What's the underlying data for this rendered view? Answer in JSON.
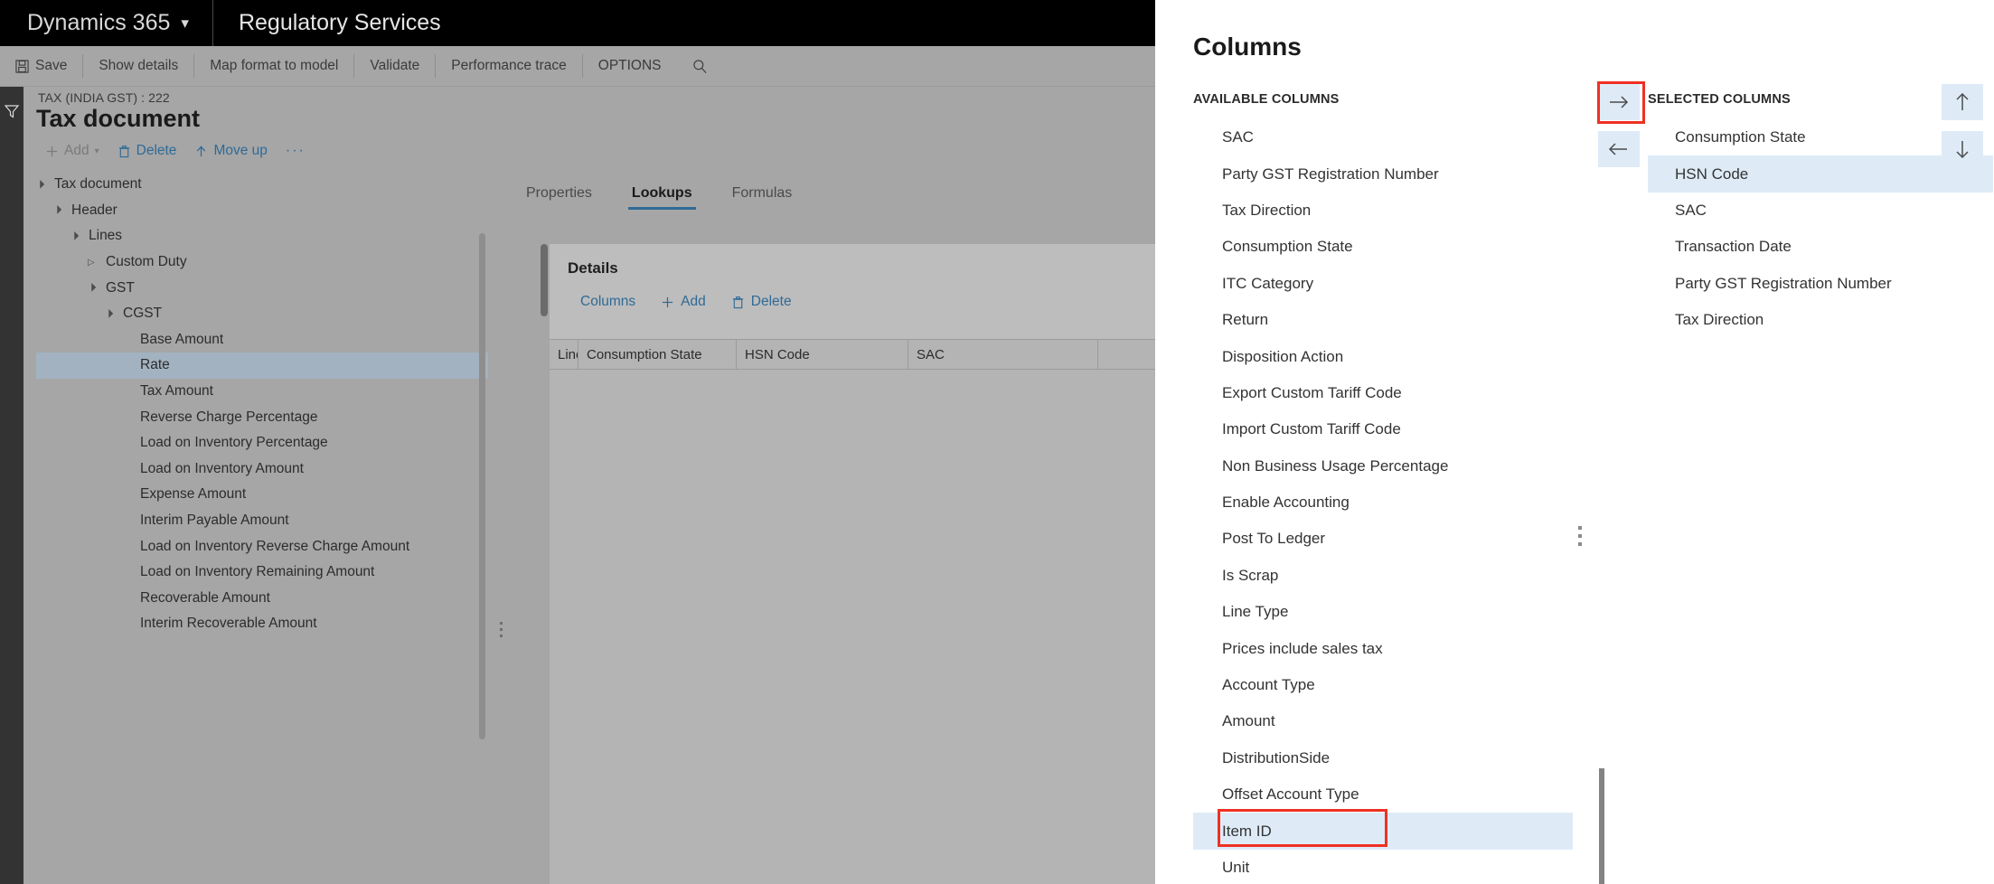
{
  "topbar": {
    "brand": "Dynamics 365",
    "brand_chevron": "chevron-down",
    "module": "Regulatory Services"
  },
  "command_bar": {
    "items": [
      {
        "label": "Save",
        "icon": "save-icon"
      },
      {
        "label": "Show details",
        "icon": ""
      },
      {
        "label": "Map format to model",
        "icon": ""
      },
      {
        "label": "Validate",
        "icon": ""
      },
      {
        "label": "Performance trace",
        "icon": ""
      },
      {
        "label": "OPTIONS",
        "icon": ""
      }
    ],
    "search_icon": "search-icon"
  },
  "page": {
    "breadcrumb": "TAX (INDIA GST) : 222",
    "title": "Tax document"
  },
  "tree_toolbar": {
    "add": "Add",
    "delete": "Delete",
    "move_up": "Move up",
    "overflow": "···"
  },
  "tree": {
    "nodes": [
      {
        "label": "Tax document",
        "indent": 0,
        "state": "open",
        "selected": false
      },
      {
        "label": "Header",
        "indent": 1,
        "state": "open",
        "selected": false
      },
      {
        "label": "Lines",
        "indent": 2,
        "state": "open",
        "selected": false
      },
      {
        "label": "Custom Duty",
        "indent": 3,
        "state": "closed",
        "selected": false
      },
      {
        "label": "GST",
        "indent": 3,
        "state": "open",
        "selected": false
      },
      {
        "label": "CGST",
        "indent": 4,
        "state": "open",
        "selected": false
      },
      {
        "label": "Base Amount",
        "indent": 5,
        "state": "leaf",
        "selected": false
      },
      {
        "label": "Rate",
        "indent": 5,
        "state": "leaf",
        "selected": true
      },
      {
        "label": "Tax Amount",
        "indent": 5,
        "state": "leaf",
        "selected": false
      },
      {
        "label": "Reverse Charge Percentage",
        "indent": 5,
        "state": "leaf",
        "selected": false
      },
      {
        "label": "Load on Inventory Percentage",
        "indent": 5,
        "state": "leaf",
        "selected": false
      },
      {
        "label": "Load on Inventory Amount",
        "indent": 5,
        "state": "leaf",
        "selected": false
      },
      {
        "label": "Expense Amount",
        "indent": 5,
        "state": "leaf",
        "selected": false
      },
      {
        "label": "Interim Payable Amount",
        "indent": 5,
        "state": "leaf",
        "selected": false
      },
      {
        "label": "Load on Inventory Reverse Charge Amount",
        "indent": 5,
        "state": "leaf",
        "selected": false
      },
      {
        "label": "Load on Inventory Remaining Amount",
        "indent": 5,
        "state": "leaf",
        "selected": false
      },
      {
        "label": "Recoverable Amount",
        "indent": 5,
        "state": "leaf",
        "selected": false
      },
      {
        "label": "Interim Recoverable Amount",
        "indent": 5,
        "state": "leaf",
        "selected": false
      }
    ]
  },
  "tabs": [
    {
      "label": "Properties",
      "active": false
    },
    {
      "label": "Lookups",
      "active": true
    },
    {
      "label": "Formulas",
      "active": false
    }
  ],
  "details": {
    "title": "Details",
    "toolbar": {
      "columns": "Columns",
      "add": "Add",
      "delete": "Delete"
    },
    "grid_headers": [
      "Line",
      "Consumption State",
      "HSN Code",
      "SAC"
    ],
    "rows": []
  },
  "dialog": {
    "title": "Columns",
    "available_label": "AVAILABLE COLUMNS",
    "selected_label": "SELECTED COLUMNS",
    "buttons": {
      "move_right": "→",
      "move_left": "←",
      "move_up": "↑",
      "move_down": "↓"
    },
    "available_columns": [
      {
        "label": "SAC",
        "selected": false
      },
      {
        "label": "Party GST Registration Number",
        "selected": false
      },
      {
        "label": "Tax Direction",
        "selected": false
      },
      {
        "label": "Consumption State",
        "selected": false
      },
      {
        "label": "ITC Category",
        "selected": false
      },
      {
        "label": "Return",
        "selected": false
      },
      {
        "label": "Disposition Action",
        "selected": false
      },
      {
        "label": "Export Custom Tariff Code",
        "selected": false
      },
      {
        "label": "Import Custom Tariff Code",
        "selected": false
      },
      {
        "label": "Non Business Usage Percentage",
        "selected": false
      },
      {
        "label": "Enable Accounting",
        "selected": false
      },
      {
        "label": "Post To Ledger",
        "selected": false
      },
      {
        "label": "Is Scrap",
        "selected": false
      },
      {
        "label": "Line Type",
        "selected": false
      },
      {
        "label": "Prices include sales tax",
        "selected": false
      },
      {
        "label": "Account Type",
        "selected": false
      },
      {
        "label": "Amount",
        "selected": false
      },
      {
        "label": "DistributionSide",
        "selected": false
      },
      {
        "label": "Offset Account Type",
        "selected": false
      },
      {
        "label": "Item ID",
        "selected": true
      },
      {
        "label": "Unit",
        "selected": false
      }
    ],
    "selected_columns": [
      {
        "label": "Consumption State",
        "selected": false
      },
      {
        "label": "HSN Code",
        "selected": true
      },
      {
        "label": "SAC",
        "selected": false
      },
      {
        "label": "Transaction Date",
        "selected": false
      },
      {
        "label": "Party GST Registration Number",
        "selected": false
      },
      {
        "label": "Tax Direction",
        "selected": false
      }
    ]
  },
  "annotations": {
    "color": "#ee3124",
    "boxes": [
      "move-right-button",
      "item-id-list-item"
    ]
  }
}
